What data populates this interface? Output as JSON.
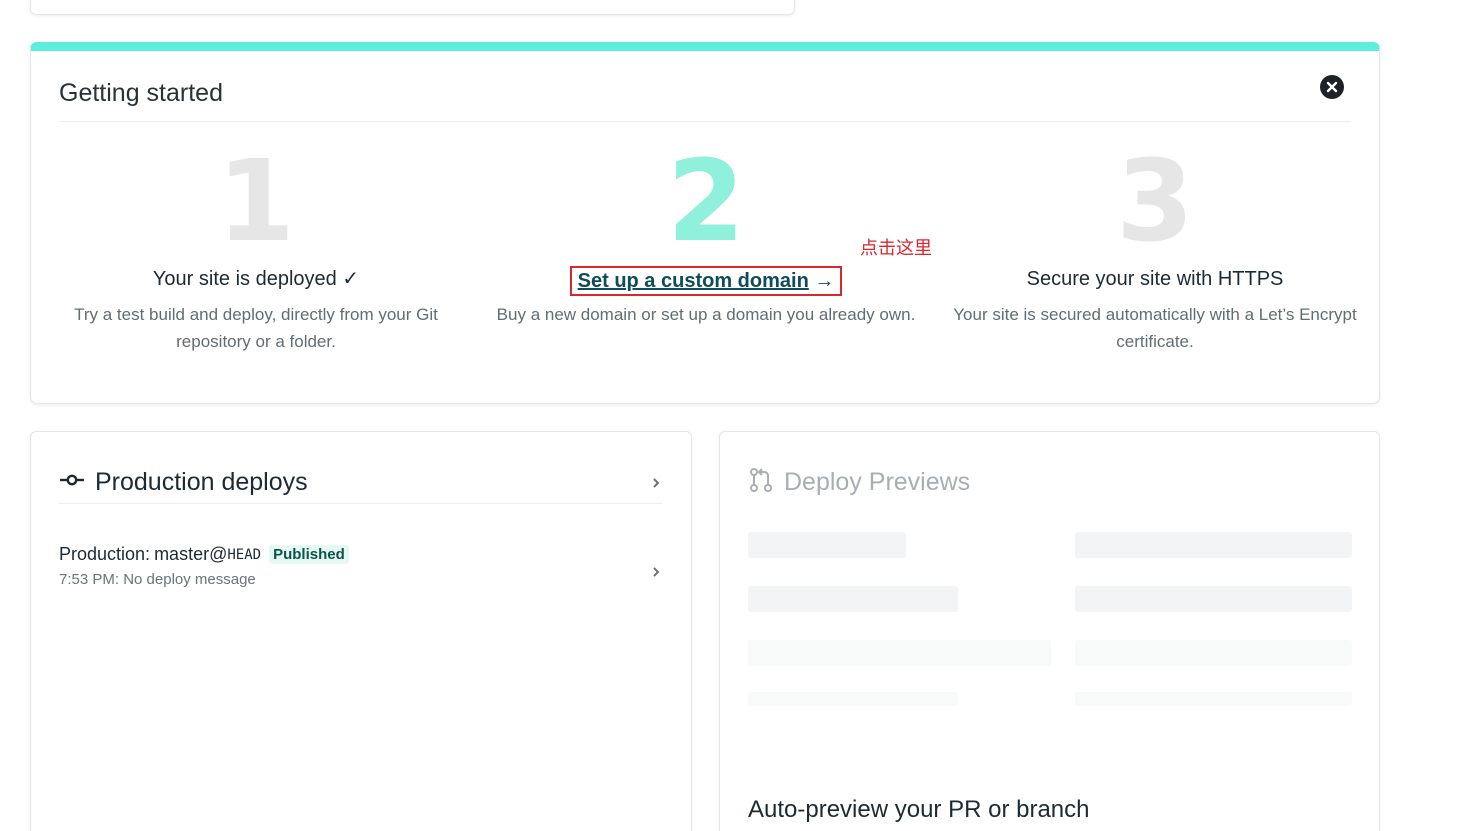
{
  "getting_started": {
    "title": "Getting started",
    "steps": [
      {
        "number": "1",
        "title": "Your site is deployed ✓",
        "description": "Try a test build and deploy, directly from your Git repository or a folder."
      },
      {
        "number": "2",
        "link_text": "Set up a custom domain",
        "arrow": "→",
        "description": "Buy a new domain or set up a domain you already own."
      },
      {
        "number": "3",
        "title": "Secure your site with HTTPS",
        "description": "Your site is secured automatically with a Let’s Encrypt certificate."
      }
    ],
    "annotation": "点击这里"
  },
  "production_deploys": {
    "title": "Production deploys",
    "deploy": {
      "label": "Production:",
      "branch": "master@",
      "ref": "HEAD",
      "status": "Published",
      "meta": "7:53 PM: No deploy message"
    }
  },
  "deploy_previews": {
    "title": "Deploy Previews",
    "auto_preview_heading": "Auto-preview your PR or branch"
  },
  "colors": {
    "accent_teal": "#5ceedb",
    "step2_mint": "#8ff0dc",
    "link": "#0e4c5b",
    "annotation_red": "#d9272e"
  }
}
